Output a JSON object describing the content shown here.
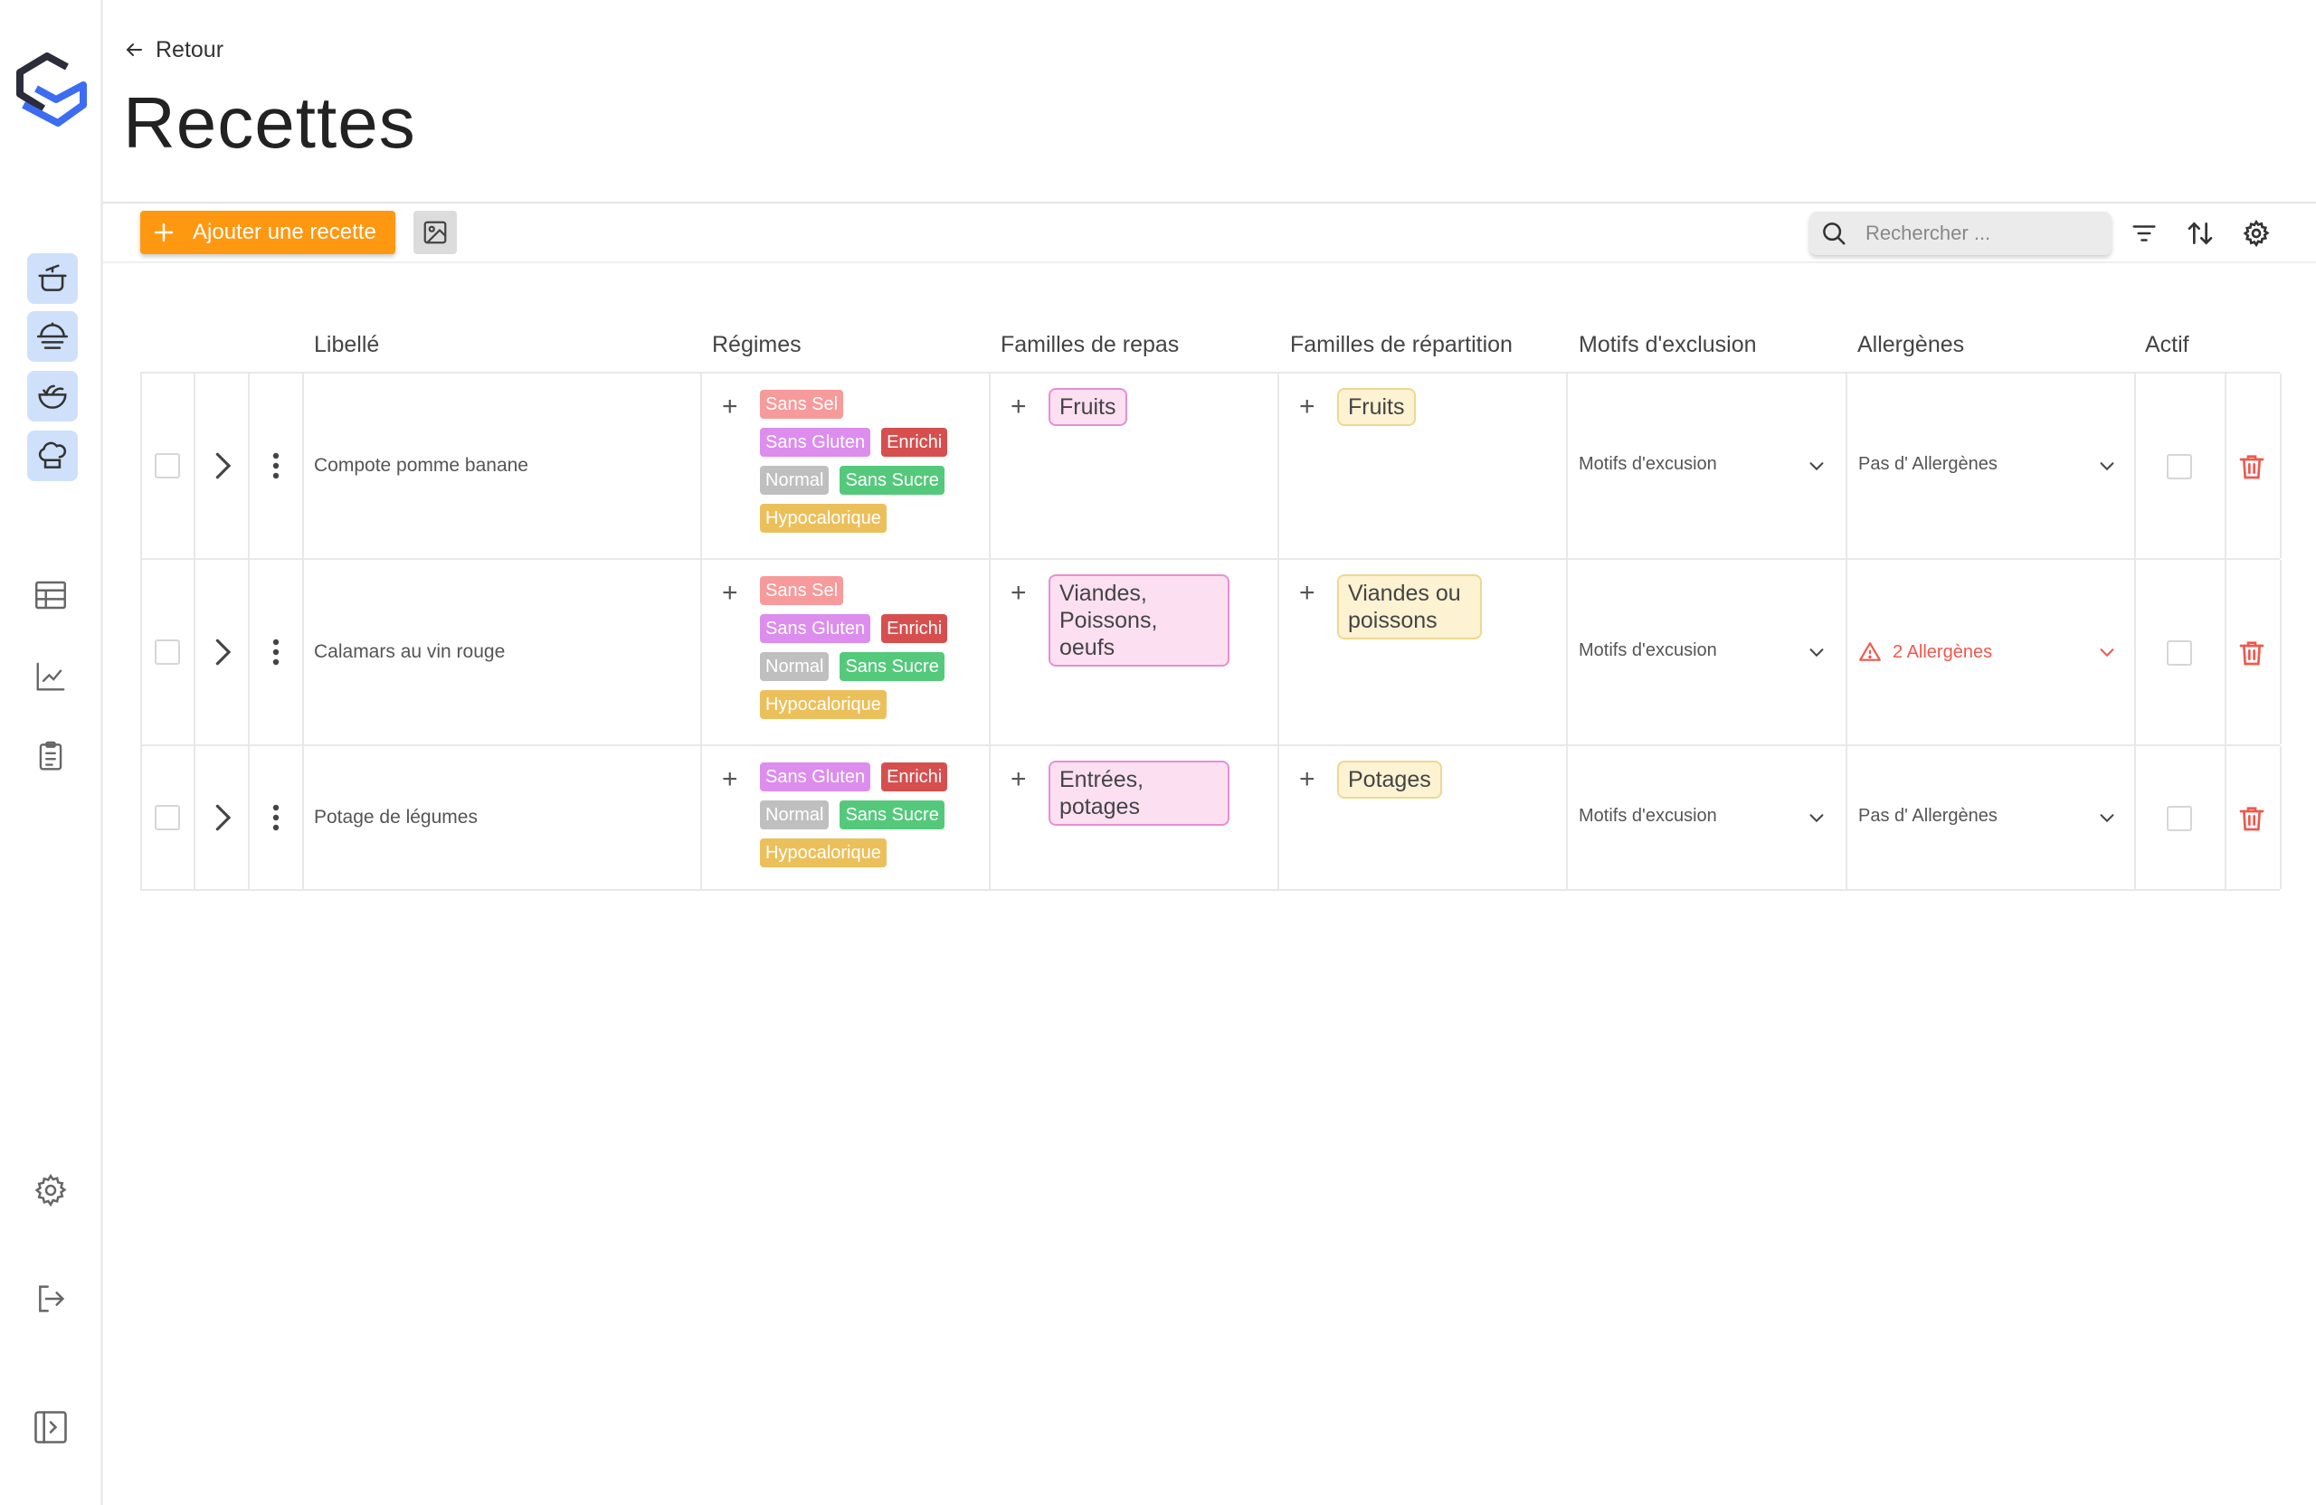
{
  "header": {
    "back_label": "Retour",
    "title": "Recettes"
  },
  "toolbar": {
    "add_label": "Ajouter une recette",
    "search_placeholder": "Rechercher ..."
  },
  "table": {
    "columns": [
      "Libellé",
      "Régimes",
      "Familles de repas",
      "Familles de répartition",
      "Motifs d'exclusion",
      "Allergènes",
      "Actif"
    ],
    "rows": [
      {
        "name": "Compote pomme banane",
        "regimes": [
          {
            "label": "Sans Sel",
            "color": "#f79a9b"
          },
          {
            "label": "Sans Gluten",
            "color": "#dc8ded"
          },
          {
            "label": "Enrichi",
            "color": "#d64f4e"
          },
          {
            "label": "Normal",
            "color": "#bfbfbf"
          },
          {
            "label": "Sans Sucre",
            "color": "#54c97c"
          },
          {
            "label": "Hypocalorique",
            "color": "#ebc05b"
          }
        ],
        "repas": "Fruits",
        "repartition": "Fruits",
        "motifs": "Motifs d'excusion",
        "allergenes": "Pas d' Allergènes",
        "allergene_alert": false
      },
      {
        "name": "Calamars au vin rouge",
        "regimes": [
          {
            "label": "Sans Sel",
            "color": "#f79a9b"
          },
          {
            "label": "Sans Gluten",
            "color": "#dc8ded"
          },
          {
            "label": "Enrichi",
            "color": "#d64f4e"
          },
          {
            "label": "Normal",
            "color": "#bfbfbf"
          },
          {
            "label": "Sans Sucre",
            "color": "#54c97c"
          },
          {
            "label": "Hypocalorique",
            "color": "#ebc05b"
          }
        ],
        "repas": "Viandes, Poissons, oeufs",
        "repartition": "Viandes ou poissons",
        "motifs": "Motifs d'excusion",
        "allergenes": "2 Allergènes",
        "allergene_alert": true
      },
      {
        "name": "Potage de légumes",
        "regimes": [
          {
            "label": "Sans Gluten",
            "color": "#dc8ded"
          },
          {
            "label": "Enrichi",
            "color": "#d64f4e"
          },
          {
            "label": "Normal",
            "color": "#bfbfbf"
          },
          {
            "label": "Sans Sucre",
            "color": "#54c97c"
          },
          {
            "label": "Hypocalorique",
            "color": "#ebc05b"
          }
        ],
        "repas": "Entrées, potages",
        "repartition": "Potages",
        "motifs": "Motifs d'excusion",
        "allergenes": "Pas d' Allergènes",
        "allergene_alert": false
      }
    ]
  },
  "colors": {
    "accent": "#ff9811",
    "nav_active_bg": "#cfe0fb",
    "danger": "#f0574d",
    "logo_dark": "#2b2d3a",
    "logo_blue": "#3b6cf2"
  }
}
